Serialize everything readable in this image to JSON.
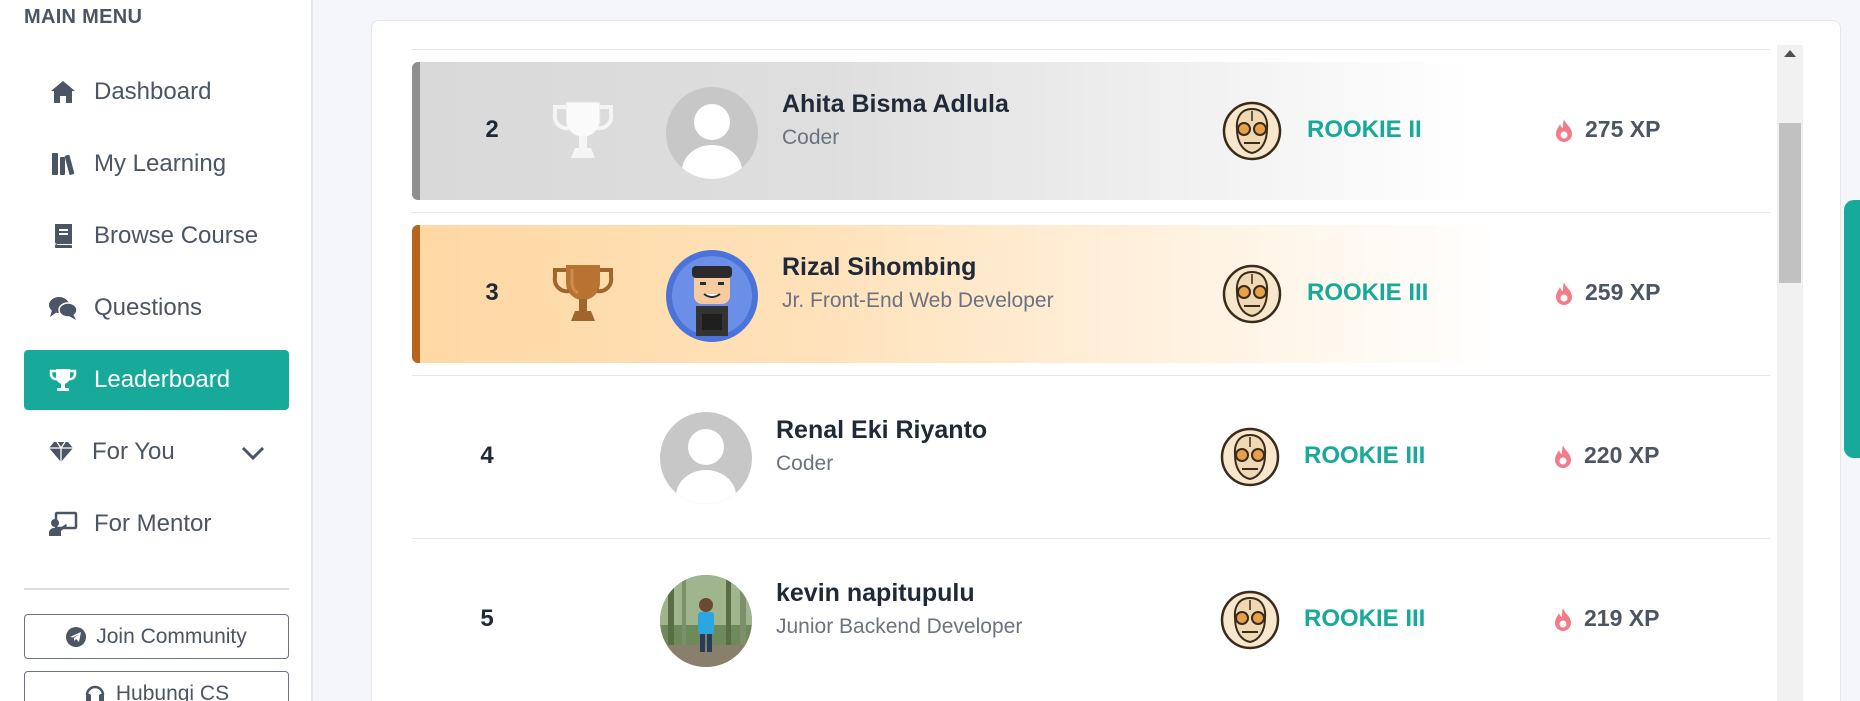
{
  "sidebar": {
    "menu_title": "MAIN MENU",
    "items": [
      {
        "label": "Dashboard",
        "icon": "home-icon"
      },
      {
        "label": "My Learning",
        "icon": "books-icon"
      },
      {
        "label": "Browse Course",
        "icon": "book-icon"
      },
      {
        "label": "Questions",
        "icon": "comments-icon"
      },
      {
        "label": "Leaderboard",
        "icon": "trophy-icon",
        "active": true
      },
      {
        "label": "For You",
        "icon": "gem-icon"
      },
      {
        "label": "For Mentor",
        "icon": "chalkboard-teacher-icon"
      }
    ],
    "join_community": "Join Community",
    "contact_cs": "Hubungi CS"
  },
  "leaderboard": {
    "rows": [
      {
        "rank": "2",
        "name": "Ahita Bisma Adlula",
        "role": "Coder",
        "level": "ROOKIE II",
        "xp": "275 XP",
        "medal": "silver",
        "avatar": "default-avatar"
      },
      {
        "rank": "3",
        "name": "Rizal Sihombing",
        "role": "Jr. Front-End Web Developer",
        "level": "ROOKIE III",
        "xp": "259 XP",
        "medal": "bronze",
        "avatar": "cartoon-avatar"
      },
      {
        "rank": "4",
        "name": "Renal Eki Riyanto",
        "role": "Coder",
        "level": "ROOKIE III",
        "xp": "220 XP",
        "medal": "none",
        "avatar": "default-avatar"
      },
      {
        "rank": "5",
        "name": "kevin napitupulu",
        "role": "Junior Backend Developer",
        "level": "ROOKIE III",
        "xp": "219 XP",
        "medal": "none",
        "avatar": "photo-avatar"
      }
    ]
  },
  "colors": {
    "accent": "#17a99a",
    "silver": "#8f8f8f",
    "bronze": "#b5651d",
    "fire": "#f27c8a"
  }
}
